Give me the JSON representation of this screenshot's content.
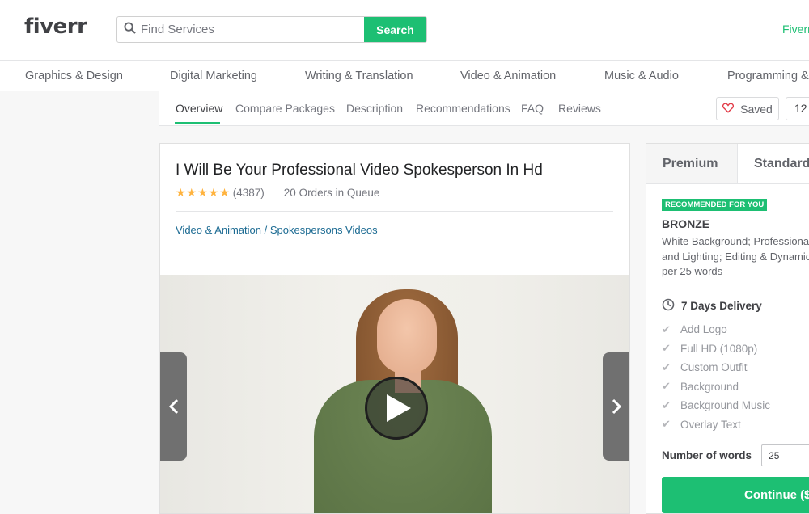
{
  "header": {
    "logo": "fiverr",
    "search_placeholder": "Find Services",
    "search_button": "Search",
    "right_link": "Fiverr"
  },
  "categories": [
    "Graphics & Design",
    "Digital Marketing",
    "Writing & Translation",
    "Video & Animation",
    "Music & Audio",
    "Programming &"
  ],
  "subnav": {
    "tabs": [
      "Overview",
      "Compare Packages",
      "Description",
      "Recommendations",
      "FAQ",
      "Reviews"
    ],
    "active_tab": "Overview",
    "saved_label": "Saved",
    "saved_count": "12"
  },
  "gig": {
    "title": "I Will Be Your Professional Video Spokesperson In Hd",
    "stars": "★★★★★",
    "rating_count": "(4387)",
    "queue": "20 Orders in Queue",
    "breadcrumb": "Video & Animation / Spokespersons Videos"
  },
  "package": {
    "tabs": [
      "Premium",
      "Standard"
    ],
    "badge": "RECOMMENDED FOR YOU",
    "name": "BRONZE",
    "description": "White Background; Professional and Lighting; Editing & Dynamic per 25 words",
    "delivery": "7 Days Delivery",
    "features": [
      "Add Logo",
      "Full HD (1080p)",
      "Custom Outfit",
      "Background",
      "Background Music",
      "Overlay Text"
    ],
    "words_label": "Number of words",
    "words_value": "25",
    "continue_label": "Continue ($"
  },
  "colors": {
    "accent": "#1dbf73",
    "star": "#ffb33e",
    "link": "#1b6a92"
  }
}
